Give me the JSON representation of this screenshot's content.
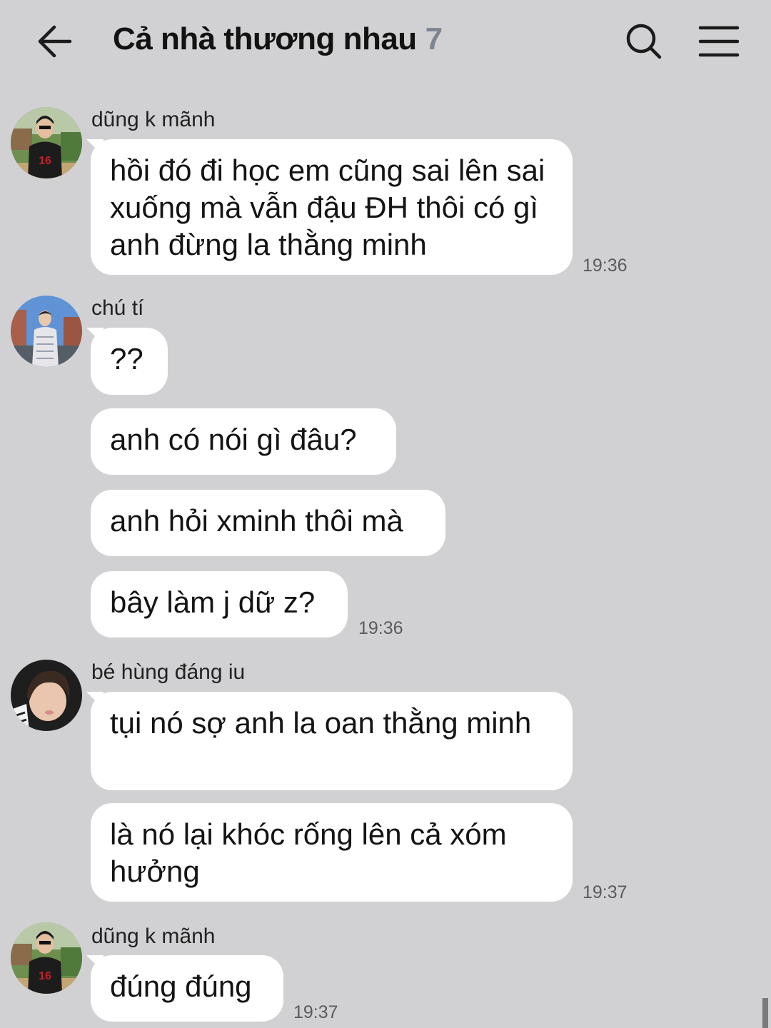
{
  "header": {
    "back_icon": "arrow-left-icon",
    "title": "Cả nhà thương nhau",
    "member_count": "7",
    "search_icon": "search-icon",
    "menu_icon": "hamburger-menu-icon"
  },
  "messages": [
    {
      "sender": "dũng k mãnh",
      "bubbles": [
        "hồi đó đi học em cũng sai lên sai xuống mà vẫn đậu ĐH thôi có gì anh đừng la thằng minh"
      ],
      "time": "19:36"
    },
    {
      "sender": "chú tí",
      "bubbles": [
        "??",
        "anh có nói gì đâu?",
        "anh hỏi xminh thôi mà",
        "bây làm j dữ z?"
      ],
      "time": "19:36"
    },
    {
      "sender": "bé hùng đáng iu",
      "bubbles": [
        "tụi nó sợ anh la oan thằng minh",
        "là nó lại khóc rống lên cả xóm hưởng"
      ],
      "time": "19:37"
    },
    {
      "sender": "dũng k mãnh",
      "bubbles": [
        "đúng đúng"
      ],
      "time": "19:37"
    }
  ],
  "colors": {
    "background": "#d1d1d3",
    "bubble": "#ffffff",
    "member_count": "#7d8590"
  }
}
